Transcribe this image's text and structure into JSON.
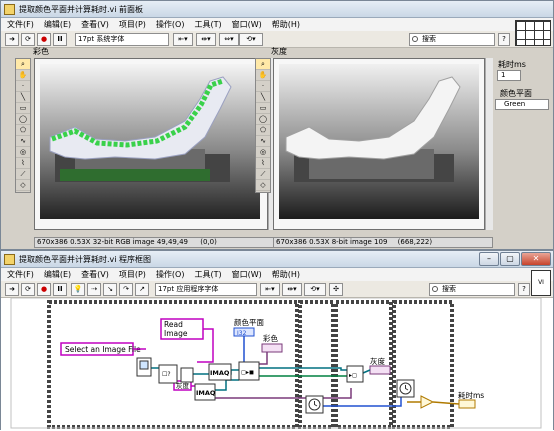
{
  "front_panel": {
    "title": "提取颜色平面并计算耗时.vi 前面板",
    "menu": [
      "文件(F)",
      "编辑(E)",
      "查看(V)",
      "项目(P)",
      "操作(O)",
      "工具(T)",
      "窗口(W)",
      "帮助(H)"
    ],
    "font_selector": "17pt 系统字体",
    "search_placeholder": "搜索",
    "color_label": "彩色",
    "gray_label": "灰度",
    "color_status_left": "670x386 0.53X 32-bit RGB image 49,49,49",
    "color_status_right": "(0,0)",
    "gray_status_left": "670x386 0.53X 8-bit image 109",
    "gray_status_right": "(668,222)",
    "time_label": "耗时ms",
    "time_value": "1",
    "plane_label": "颜色平面",
    "plane_value": "Green"
  },
  "block_diagram": {
    "title": "提取颜色平面并计算耗时.vi 程序框图",
    "menu": [
      "文件(F)",
      "编辑(E)",
      "查看(V)",
      "项目(P)",
      "操作(O)",
      "工具(T)",
      "窗口(W)",
      "帮助(H)"
    ],
    "font_selector": "17pt 应用程序字体",
    "search_placeholder": "搜索",
    "read_image": "Read\nImage",
    "select_file": "Select an Image File",
    "plane_label": "颜色平面",
    "plane_terminal": "I32",
    "color_term_label": "彩色",
    "gray_term_label": "灰度",
    "gray_const": "灰度",
    "time_term_label": "耗时ms",
    "imaq1": "IMAQ",
    "imaq2": "IMAQ",
    "imaq3": "IMAQ"
  },
  "colors": {
    "pink_wire": "#c000c0",
    "blue_wire": "#2050d0",
    "green_wire": "#008040",
    "teal_wire": "#007080",
    "highlight_green": "#4ec94e"
  }
}
